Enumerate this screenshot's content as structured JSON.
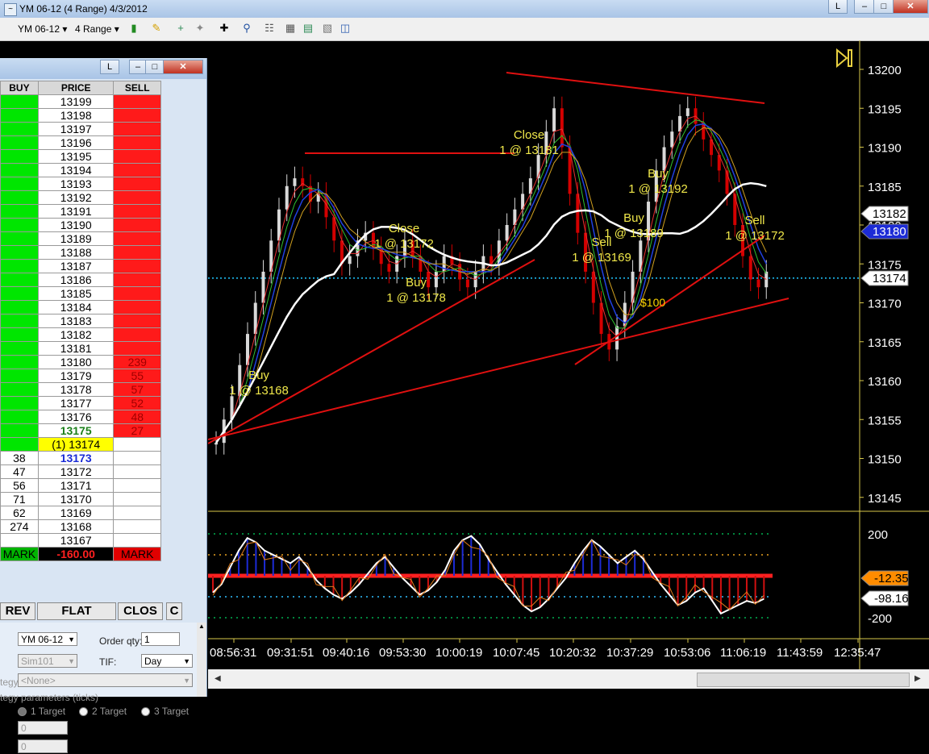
{
  "window": {
    "title": "YM 06-12 (4 Range)  4/3/2012",
    "icon": "chart-window-icon",
    "link_button": "L"
  },
  "toolbar": {
    "instrument": "YM 06-12",
    "period": "4 Range",
    "icons": [
      "candlestick-icon",
      "pencil-icon",
      "add-indicator-icon",
      "strategy-icon",
      "crosshair-icon",
      "zoom-icon",
      "properties-icon",
      "data-box-icon",
      "export-icon",
      "templates-icon"
    ]
  },
  "dom": {
    "link_button": "L",
    "headers": {
      "buy": "BUY",
      "price": "PRICE",
      "sell": "SELL"
    },
    "ladder": [
      {
        "price": "13199",
        "buy": "",
        "sell": ""
      },
      {
        "price": "13198",
        "buy": "",
        "sell": ""
      },
      {
        "price": "13197",
        "buy": "",
        "sell": ""
      },
      {
        "price": "13196",
        "buy": "",
        "sell": ""
      },
      {
        "price": "13195",
        "buy": "",
        "sell": ""
      },
      {
        "price": "13194",
        "buy": "",
        "sell": ""
      },
      {
        "price": "13193",
        "buy": "",
        "sell": ""
      },
      {
        "price": "13192",
        "buy": "",
        "sell": ""
      },
      {
        "price": "13191",
        "buy": "",
        "sell": ""
      },
      {
        "price": "13190",
        "buy": "",
        "sell": ""
      },
      {
        "price": "13189",
        "buy": "",
        "sell": ""
      },
      {
        "price": "13188",
        "buy": "",
        "sell": ""
      },
      {
        "price": "13187",
        "buy": "",
        "sell": ""
      },
      {
        "price": "13186",
        "buy": "",
        "sell": ""
      },
      {
        "price": "13185",
        "buy": "",
        "sell": ""
      },
      {
        "price": "13184",
        "buy": "",
        "sell": ""
      },
      {
        "price": "13183",
        "buy": "",
        "sell": ""
      },
      {
        "price": "13182",
        "buy": "",
        "sell": ""
      },
      {
        "price": "13181",
        "buy": "",
        "sell": ""
      },
      {
        "price": "13180",
        "buy": "",
        "sell": "239"
      },
      {
        "price": "13179",
        "buy": "",
        "sell": "55"
      },
      {
        "price": "13178",
        "buy": "",
        "sell": "57"
      },
      {
        "price": "13177",
        "buy": "",
        "sell": "52"
      },
      {
        "price": "13176",
        "buy": "",
        "sell": "48"
      },
      {
        "price": "13175",
        "buy": "",
        "sell": "27"
      },
      {
        "price": "(1) 13174",
        "buy": "",
        "sell": ""
      },
      {
        "price": "13173",
        "buy": "38",
        "sell": ""
      },
      {
        "price": "13172",
        "buy": "47",
        "sell": ""
      },
      {
        "price": "13171",
        "buy": "56",
        "sell": ""
      },
      {
        "price": "13170",
        "buy": "71",
        "sell": ""
      },
      {
        "price": "13169",
        "buy": "62",
        "sell": ""
      },
      {
        "price": "13168",
        "buy": "274",
        "sell": ""
      },
      {
        "price": "13167",
        "buy": "",
        "sell": ""
      }
    ],
    "mark_left": "MARK",
    "pnl": "-160.00",
    "mark_right": "MARK",
    "buttons": {
      "rev": "REV",
      "flat": "FLAT",
      "close": "CLOS",
      "c": "C"
    },
    "instrument": "YM 06-12",
    "account": "Sim101",
    "order_qty_label": "Order qty:",
    "order_qty": "1",
    "tif_label": "TIF:",
    "tif": "Day",
    "strategy_label": "tegy:",
    "strategy": "<None>",
    "strategy_params_label": "tegy parameters (ticks)",
    "targets": [
      "1 Target",
      "2 Target",
      "3 Target"
    ],
    "field_a": "0",
    "field_b": "0"
  },
  "chart_data": [
    {
      "type": "candlestick",
      "instrument": "YM 06-12",
      "period": "4 Range",
      "y_ticks": [
        13200,
        13195,
        13190,
        13185,
        13180,
        13175,
        13170,
        13165,
        13160,
        13155,
        13150,
        13145
      ],
      "ylim": [
        13143,
        13203
      ],
      "x_ticks": [
        "08:56:31",
        "09:31:51",
        "09:40:16",
        "09:53:30",
        "10:00:19",
        "10:07:45",
        "10:20:32",
        "10:37:29",
        "10:53:06",
        "11:06:19",
        "11:43:59",
        "12:35:47"
      ],
      "last_price": 13174,
      "price_markers": [
        {
          "value": "13182",
          "color": "#ffffff"
        },
        {
          "value": "13180",
          "color": "#1c2bd6"
        },
        {
          "value": "13174",
          "color": "#ffffff"
        }
      ],
      "trades": [
        {
          "action": "Buy",
          "text": "1 @ 13168",
          "bar": 8
        },
        {
          "action": "Close",
          "text": "1 @ 13172",
          "bar": 33
        },
        {
          "action": "Buy",
          "text": "1 @ 13178",
          "bar": 38
        },
        {
          "action": "Close",
          "text": "1 @ 13181",
          "bar": 56
        },
        {
          "action": "Sell",
          "text": "1 @ 13169",
          "bar": 68
        },
        {
          "action": "Buy",
          "text": "1 @ 13189",
          "bar": 74
        },
        {
          "action": "Buy",
          "text": "1 @ 13192",
          "bar": 79
        },
        {
          "action": "Sell",
          "text": "1 @ 13172",
          "bar": 96
        }
      ],
      "annotation": "$100",
      "colors": {
        "up": "#d9d9d9",
        "down": "#d40000",
        "trendline": "#e01010",
        "sma": "#ffffff",
        "text": "#f0e84a",
        "lastline": "#1fc7ff"
      }
    },
    {
      "type": "oscillator",
      "y_ticks": [
        200,
        -200
      ],
      "ylim": [
        -260,
        260
      ],
      "markers": [
        {
          "value": "-12.35",
          "color": "#ff8c00"
        },
        {
          "value": "-98.16",
          "color": "#ffffff"
        }
      ],
      "levels": [
        200,
        100,
        0,
        -100,
        -200
      ]
    }
  ]
}
